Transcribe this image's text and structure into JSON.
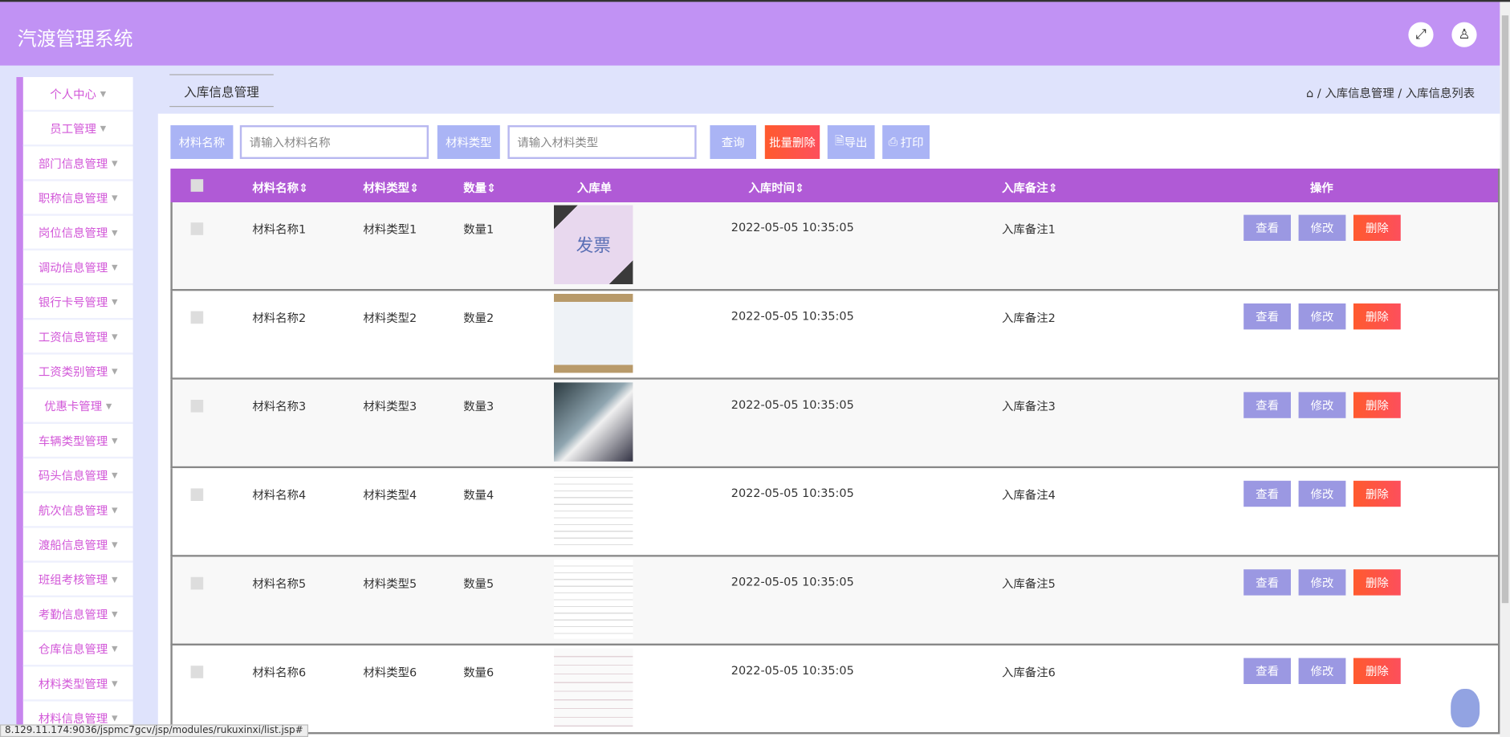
{
  "app": {
    "title": "汽渡管理系统"
  },
  "header_icons": [
    "fullscreen-icon",
    "user-icon"
  ],
  "sidebar": {
    "items": [
      "个人中心",
      "员工管理",
      "部门信息管理",
      "职称信息管理",
      "岗位信息管理",
      "调动信息管理",
      "银行卡号管理",
      "工资信息管理",
      "工资类别管理",
      "优惠卡管理",
      "车辆类型管理",
      "码头信息管理",
      "航次信息管理",
      "渡船信息管理",
      "班组考核管理",
      "考勤信息管理",
      "仓库信息管理",
      "材料类型管理",
      "材料信息管理"
    ]
  },
  "tab": {
    "label": "入库信息管理"
  },
  "breadcrumb": {
    "sep": "/",
    "items": [
      "入库信息管理",
      "入库信息列表"
    ]
  },
  "search": {
    "name_label": "材料名称",
    "name_placeholder": "请输入材料名称",
    "type_label": "材料类型",
    "type_placeholder": "请输入材料类型",
    "query": "查询",
    "batch_delete": "批量删除",
    "export": "导出",
    "print": "打印"
  },
  "table": {
    "headers": [
      "材料名称",
      "材料类型",
      "数量",
      "入库单",
      "入库时间",
      "入库备注",
      "操作"
    ],
    "sort_glyph": "⇕",
    "actions": {
      "view": "查看",
      "edit": "修改",
      "delete": "删除"
    },
    "rows": [
      {
        "name": "材料名称1",
        "type": "材料类型1",
        "qty": "数量1",
        "time": "2022-05-05 10:35:05",
        "note": "入库备注1",
        "img": "发票"
      },
      {
        "name": "材料名称2",
        "type": "材料类型2",
        "qty": "数量2",
        "time": "2022-05-05 10:35:05",
        "note": "入库备注2",
        "img": ""
      },
      {
        "name": "材料名称3",
        "type": "材料类型3",
        "qty": "数量3",
        "time": "2022-05-05 10:35:05",
        "note": "入库备注3",
        "img": ""
      },
      {
        "name": "材料名称4",
        "type": "材料类型4",
        "qty": "数量4",
        "time": "2022-05-05 10:35:05",
        "note": "入库备注4",
        "img": ""
      },
      {
        "name": "材料名称5",
        "type": "材料类型5",
        "qty": "数量5",
        "time": "2022-05-05 10:35:05",
        "note": "入库备注5",
        "img": ""
      },
      {
        "name": "材料名称6",
        "type": "材料类型6",
        "qty": "数量6",
        "time": "2022-05-05 10:35:05",
        "note": "入库备注6",
        "img": ""
      }
    ]
  },
  "statusbar": {
    "url": "8.129.11.174:9036/jspmc7gcv/jsp/modules/rukuxinxi/list.jsp#"
  }
}
